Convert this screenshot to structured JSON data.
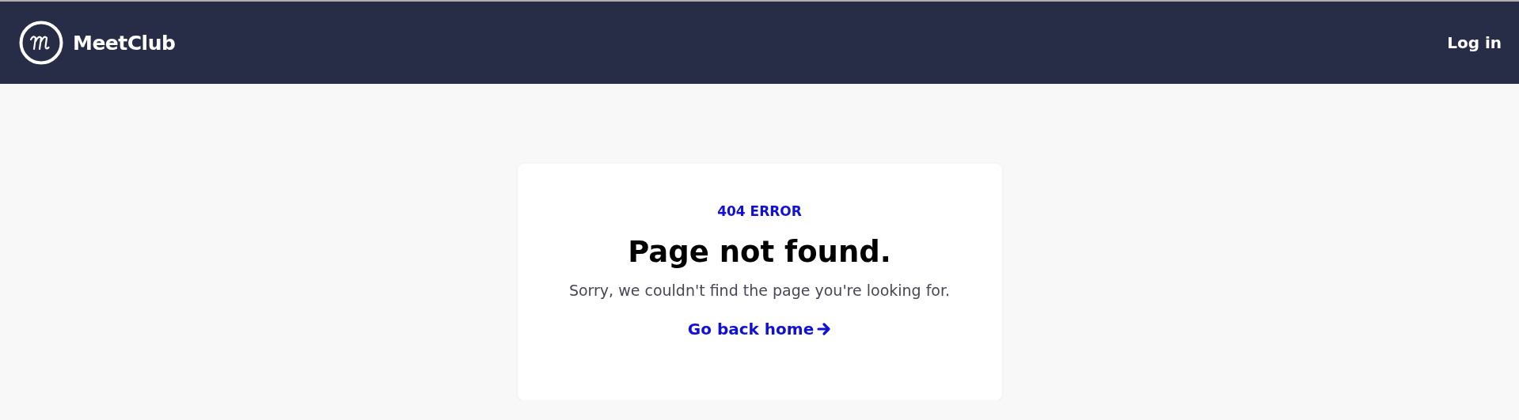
{
  "header": {
    "brand": "MeetClub",
    "login": "Log in"
  },
  "error_card": {
    "code": "404 ERROR",
    "title": "Page not found.",
    "message": "Sorry, we couldn't find the page you're looking for.",
    "link": "Go back home"
  }
}
